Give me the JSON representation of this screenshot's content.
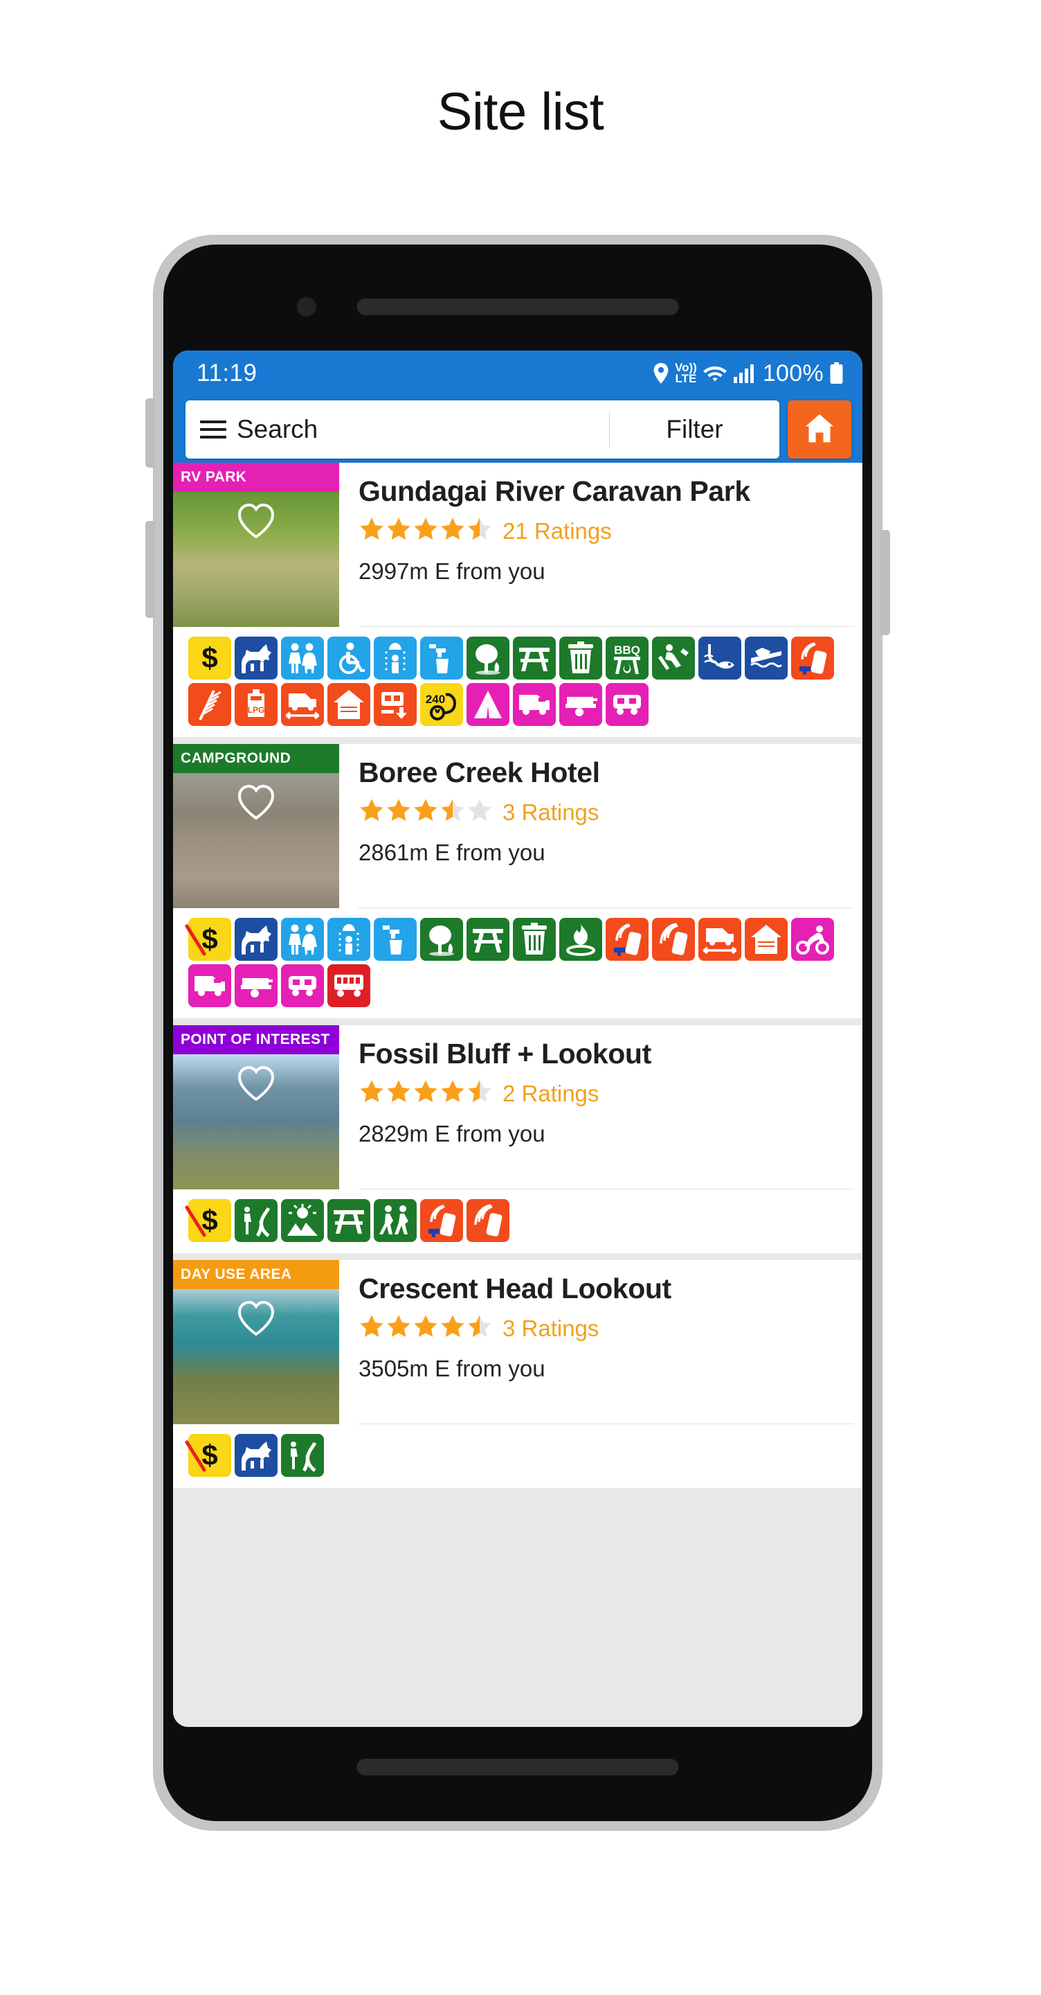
{
  "page": {
    "title": "Site list"
  },
  "status_bar": {
    "time": "11:19",
    "network": "VoLTE",
    "volte_top": "Vo))",
    "volte_bottom": "LTE",
    "battery": "100%"
  },
  "search_bar": {
    "menu_icon": "hamburger-icon",
    "search_label": "Search",
    "filter_label": "Filter",
    "home_icon": "home-icon"
  },
  "colors": {
    "accent_blue": "#1878d2",
    "home_orange": "#f4661e",
    "star_gold": "#f9a01b",
    "star_empty": "#e3e3e3",
    "badge_rv_park": "#e520b4",
    "badge_campground": "#1d7a2a",
    "badge_poi": "#8f00d6",
    "badge_day_use": "#f59b12"
  },
  "sites": [
    {
      "badge": "RV PARK",
      "badge_color": "#e520b4",
      "name": "Gundagai River Caravan Park",
      "rating": 4.5,
      "ratings_label": "21 Ratings",
      "distance": "2997m E from you",
      "favourite_icon": "heart-outline-icon",
      "amenities": [
        {
          "icon": "dollar-icon",
          "color": "#f9d616",
          "free": false
        },
        {
          "icon": "dog-icon",
          "color": "#1d4ea1"
        },
        {
          "icon": "toilets-icon",
          "color": "#23a3e8"
        },
        {
          "icon": "wheelchair-icon",
          "color": "#23a3e8"
        },
        {
          "icon": "shower-icon",
          "color": "#23a3e8"
        },
        {
          "icon": "drinking-water-icon",
          "color": "#23a3e8"
        },
        {
          "icon": "tree-icon",
          "color": "#1d7a2a"
        },
        {
          "icon": "picnic-table-icon",
          "color": "#1d7a2a"
        },
        {
          "icon": "rubbish-bin-icon",
          "color": "#1d7a2a"
        },
        {
          "icon": "bbq-icon",
          "color": "#1d7a2a",
          "label": "BBQ"
        },
        {
          "icon": "kayak-icon",
          "color": "#1d7a2a"
        },
        {
          "icon": "fishing-icon",
          "color": "#1d4ea1"
        },
        {
          "icon": "boat-ramp-icon",
          "color": "#1d4ea1"
        },
        {
          "icon": "telstra-mobile-icon",
          "color": "#f24b1c"
        },
        {
          "icon": "tv-antenna-icon",
          "color": "#f24b1c"
        },
        {
          "icon": "lpg-icon",
          "color": "#f24b1c",
          "label": "LPG"
        },
        {
          "icon": "rv-length-icon",
          "color": "#f24b1c"
        },
        {
          "icon": "cabin-icon",
          "color": "#f24b1c"
        },
        {
          "icon": "dump-point-icon",
          "color": "#f24b1c"
        },
        {
          "icon": "power-240v-icon",
          "color": "#f9d616",
          "label": "240"
        },
        {
          "icon": "tent-icon",
          "color": "#e520b4"
        },
        {
          "icon": "campervan-icon",
          "color": "#e520b4"
        },
        {
          "icon": "camper-trailer-icon",
          "color": "#e520b4"
        },
        {
          "icon": "caravan-icon",
          "color": "#e520b4"
        }
      ]
    },
    {
      "badge": "CAMPGROUND",
      "badge_color": "#1d7a2a",
      "name": "Boree Creek Hotel",
      "rating": 3.5,
      "ratings_label": "3 Ratings",
      "distance": "2861m E from you",
      "favourite_icon": "heart-outline-icon",
      "amenities": [
        {
          "icon": "free-icon",
          "color": "#f9d616",
          "free": true
        },
        {
          "icon": "dog-icon",
          "color": "#1d4ea1"
        },
        {
          "icon": "toilets-icon",
          "color": "#23a3e8"
        },
        {
          "icon": "shower-icon",
          "color": "#23a3e8"
        },
        {
          "icon": "drinking-water-icon",
          "color": "#23a3e8"
        },
        {
          "icon": "tree-icon",
          "color": "#1d7a2a"
        },
        {
          "icon": "picnic-table-icon",
          "color": "#1d7a2a"
        },
        {
          "icon": "rubbish-bin-icon",
          "color": "#1d7a2a"
        },
        {
          "icon": "campfire-icon",
          "color": "#1d7a2a"
        },
        {
          "icon": "telstra-mobile-icon",
          "color": "#f24b1c"
        },
        {
          "icon": "mobile-signal-icon",
          "color": "#f24b1c"
        },
        {
          "icon": "rv-length-icon",
          "color": "#f24b1c"
        },
        {
          "icon": "cabin-icon",
          "color": "#f24b1c"
        },
        {
          "icon": "motorbike-icon",
          "color": "#e520b4"
        },
        {
          "icon": "campervan-icon",
          "color": "#e520b4"
        },
        {
          "icon": "camper-trailer-icon",
          "color": "#e520b4"
        },
        {
          "icon": "caravan-icon",
          "color": "#e520b4"
        },
        {
          "icon": "bus-icon",
          "color": "#de1f26"
        }
      ]
    },
    {
      "badge": "POINT OF INTEREST",
      "badge_color": "#8f00d6",
      "name": "Fossil Bluff + Lookout",
      "rating": 4.5,
      "ratings_label": "2 Ratings",
      "distance": "2829m E from you",
      "favourite_icon": "heart-outline-icon",
      "amenities": [
        {
          "icon": "free-icon",
          "color": "#f9d616",
          "free": true
        },
        {
          "icon": "scenic-drive-icon",
          "color": "#1d7a2a"
        },
        {
          "icon": "scenic-view-icon",
          "color": "#1d7a2a"
        },
        {
          "icon": "picnic-table-icon",
          "color": "#1d7a2a"
        },
        {
          "icon": "walking-track-icon",
          "color": "#1d7a2a"
        },
        {
          "icon": "telstra-mobile-icon",
          "color": "#f24b1c"
        },
        {
          "icon": "mobile-signal-icon",
          "color": "#f24b1c"
        }
      ]
    },
    {
      "badge": "DAY USE AREA",
      "badge_color": "#f59b12",
      "name": "Crescent Head Lookout",
      "rating": 4.5,
      "ratings_label": "3 Ratings",
      "distance": "3505m E from you",
      "favourite_icon": "heart-outline-icon",
      "amenities": [
        {
          "icon": "free-icon",
          "color": "#f9d616",
          "free": true
        },
        {
          "icon": "dog-icon",
          "color": "#1d4ea1"
        },
        {
          "icon": "scenic-drive-icon",
          "color": "#1d7a2a"
        }
      ]
    }
  ]
}
